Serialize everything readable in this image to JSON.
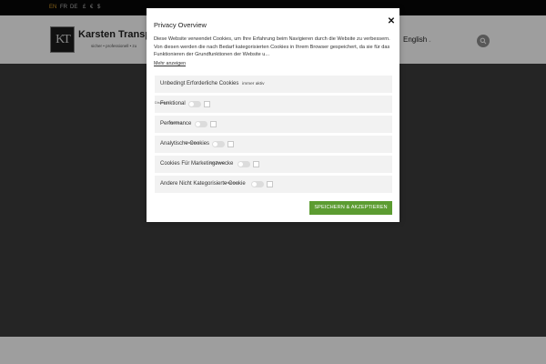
{
  "topbar": {
    "languages": [
      "EN",
      "FR",
      "DE"
    ],
    "currencies": [
      "£",
      "€",
      "$"
    ]
  },
  "header": {
    "logo_mark": "KT",
    "logo_name": "Karsten Transp",
    "tagline": "sicher • professionell • zu",
    "language": "English",
    "language_caret": "⌄"
  },
  "modal": {
    "title": "Privacy Overview",
    "close": "✕",
    "description": "Diese Website verwendet Cookies, um Ihre Erfahrung beim Navigieren durch die Website zu verbessern. Von diesen werden die nach Bedarf kategorisierten Cookies in Ihrem Browser gespeichert, da sie für das Funktionieren der Grundfunktionen der Website u...",
    "more_link": "Mehr anzeigen",
    "categories": [
      {
        "label": "Unbedingt Erforderliche Cookies",
        "note": "immer aktiv"
      },
      {
        "label": "Funktional",
        "state": "Disabled"
      },
      {
        "label": "Performance",
        "state": "Disabled"
      },
      {
        "label": "Analytische Cookies",
        "state": "Disabled"
      },
      {
        "label": "Cookies Für Marketingzwecke",
        "state": "Disabled"
      },
      {
        "label": "Andere Nicht Kategorisierte Cookie",
        "state": "Disabled"
      }
    ],
    "save_button": "SPEICHERN & AKZEPTIEREN"
  },
  "colors": {
    "topbar": "#070707",
    "hero": "#3c3c3c",
    "active_language": "#d49a2a",
    "save_button": "#5c9c31"
  }
}
